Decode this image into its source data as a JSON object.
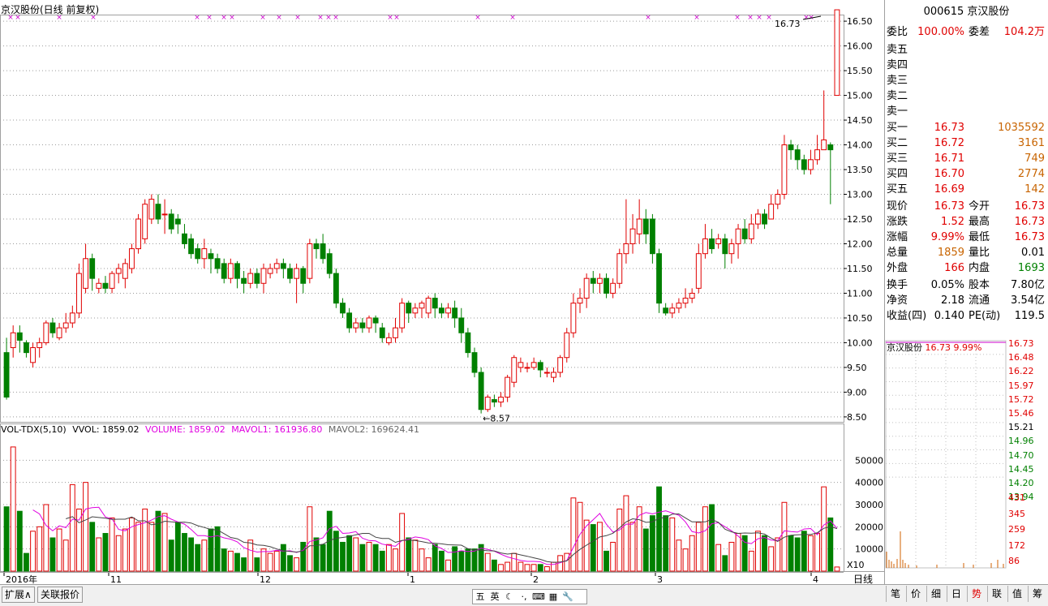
{
  "title": "京汉股份(日线 前复权)",
  "colors": {
    "up": "#e00000",
    "down": "#008000",
    "ma1": "#e000e0",
    "ma2": "#444444",
    "grid": "#9b9b9b",
    "axisText": "#000000",
    "marker": "#cc00cc"
  },
  "chart_data": {
    "type": "candlestick",
    "price_axis": {
      "min": 8.4,
      "max": 16.6,
      "ticks": [
        "16.50",
        "16.00",
        "15.50",
        "15.00",
        "14.50",
        "14.00",
        "13.50",
        "13.00",
        "12.50",
        "12.00",
        "11.50",
        "11.00",
        "10.50",
        "10.00",
        "9.50",
        "9.00",
        "8.50"
      ]
    },
    "volume_axis": {
      "max": 60000,
      "ticks": [
        "50000",
        "40000",
        "30000",
        "20000",
        "10000"
      ],
      "unit_label": "X10"
    },
    "x_labels": [
      "2016年",
      "11",
      "12",
      "1",
      "2",
      "3",
      "4"
    ],
    "period_label": "日线",
    "last_price_label": "16.73",
    "low_label": "8.57",
    "candles": [
      [
        9.8,
        8.9,
        10.1,
        8.85,
        29000
      ],
      [
        9.9,
        10.2,
        10.35,
        9.7,
        56000
      ],
      [
        10.2,
        10.05,
        10.35,
        9.8,
        27000
      ],
      [
        10.0,
        9.8,
        10.05,
        9.7,
        8000
      ],
      [
        9.6,
        9.9,
        10.0,
        9.5,
        18000
      ],
      [
        9.9,
        10.0,
        10.1,
        9.7,
        20000
      ],
      [
        10.0,
        10.4,
        10.45,
        9.95,
        30000
      ],
      [
        10.4,
        10.2,
        10.5,
        10.1,
        15000
      ],
      [
        10.1,
        10.3,
        10.4,
        10.05,
        19000
      ],
      [
        10.3,
        10.4,
        10.6,
        10.2,
        14000
      ],
      [
        10.4,
        10.6,
        10.75,
        10.3,
        39000
      ],
      [
        10.6,
        11.4,
        11.6,
        10.5,
        28000
      ],
      [
        11.1,
        11.7,
        12.0,
        11.0,
        40000
      ],
      [
        11.7,
        11.3,
        11.8,
        11.05,
        22000
      ],
      [
        11.1,
        11.2,
        11.3,
        11.0,
        15000
      ],
      [
        11.2,
        11.1,
        11.35,
        11.0,
        17000
      ],
      [
        11.1,
        11.4,
        11.45,
        11.0,
        24000
      ],
      [
        11.4,
        11.5,
        11.6,
        11.2,
        16000
      ],
      [
        11.3,
        11.6,
        11.7,
        11.1,
        19000
      ],
      [
        11.5,
        11.9,
        12.0,
        11.4,
        24000
      ],
      [
        11.9,
        12.5,
        12.6,
        11.8,
        22000
      ],
      [
        12.1,
        12.8,
        12.9,
        12.0,
        28000
      ],
      [
        12.5,
        12.9,
        13.0,
        12.4,
        22000
      ],
      [
        12.8,
        12.5,
        13.0,
        12.4,
        27000
      ],
      [
        12.6,
        12.6,
        12.9,
        12.2,
        26000
      ],
      [
        12.6,
        12.3,
        12.7,
        12.2,
        14000
      ],
      [
        12.5,
        12.4,
        12.6,
        12.2,
        22000
      ],
      [
        12.2,
        12.0,
        12.4,
        11.9,
        17000
      ],
      [
        12.1,
        11.8,
        12.2,
        11.7,
        15000
      ],
      [
        11.9,
        11.7,
        12.0,
        11.6,
        12000
      ],
      [
        11.7,
        11.9,
        12.1,
        11.5,
        14000
      ],
      [
        11.8,
        11.7,
        11.9,
        11.4,
        19000
      ],
      [
        11.7,
        11.5,
        11.8,
        11.4,
        20000
      ],
      [
        11.6,
        11.3,
        11.7,
        11.2,
        10000
      ],
      [
        11.3,
        11.6,
        11.7,
        11.2,
        9000
      ],
      [
        11.6,
        11.3,
        11.65,
        11.1,
        8000
      ],
      [
        11.3,
        11.2,
        11.45,
        11.0,
        6000
      ],
      [
        11.2,
        11.4,
        11.5,
        11.1,
        14000
      ],
      [
        11.4,
        11.2,
        11.5,
        11.1,
        6000
      ],
      [
        11.2,
        11.5,
        11.6,
        11.0,
        10000
      ],
      [
        11.4,
        11.5,
        11.6,
        11.3,
        8000
      ],
      [
        11.5,
        11.6,
        11.7,
        11.4,
        9000
      ],
      [
        11.6,
        11.5,
        11.7,
        11.3,
        12000
      ],
      [
        11.5,
        11.3,
        11.6,
        11.2,
        7000
      ],
      [
        11.3,
        11.5,
        11.6,
        10.8,
        6000
      ],
      [
        11.5,
        11.2,
        11.55,
        11.0,
        13000
      ],
      [
        11.3,
        12.0,
        12.1,
        11.2,
        29000
      ],
      [
        12.0,
        11.9,
        12.1,
        11.7,
        15000
      ],
      [
        12.0,
        11.7,
        12.2,
        11.6,
        12000
      ],
      [
        11.8,
        11.4,
        11.9,
        11.3,
        27000
      ],
      [
        11.4,
        10.8,
        11.5,
        10.7,
        18000
      ],
      [
        10.8,
        10.6,
        10.9,
        10.5,
        13000
      ],
      [
        10.6,
        10.3,
        10.7,
        10.2,
        16000
      ],
      [
        10.3,
        10.4,
        10.5,
        10.2,
        15000
      ],
      [
        10.4,
        10.3,
        10.5,
        10.2,
        12000
      ],
      [
        10.3,
        10.5,
        10.55,
        10.2,
        13000
      ],
      [
        10.5,
        10.4,
        10.55,
        10.2,
        12000
      ],
      [
        10.3,
        10.1,
        10.4,
        10.0,
        9000
      ],
      [
        10.0,
        10.1,
        10.2,
        9.95,
        12000
      ],
      [
        10.1,
        10.3,
        10.5,
        10.0,
        10000
      ],
      [
        10.3,
        10.8,
        10.9,
        10.2,
        26000
      ],
      [
        10.8,
        10.6,
        10.85,
        10.4,
        15000
      ],
      [
        10.6,
        10.7,
        10.8,
        10.5,
        14000
      ],
      [
        10.7,
        10.8,
        10.85,
        10.5,
        10000
      ],
      [
        10.6,
        10.9,
        10.95,
        10.5,
        6000
      ],
      [
        10.9,
        10.7,
        11.0,
        10.5,
        12000
      ],
      [
        10.7,
        10.6,
        10.8,
        10.5,
        9000
      ],
      [
        10.6,
        10.7,
        10.8,
        10.5,
        5000
      ],
      [
        10.7,
        10.5,
        10.85,
        10.3,
        11000
      ],
      [
        10.5,
        10.2,
        10.7,
        10.0,
        9000
      ],
      [
        10.2,
        9.8,
        10.3,
        9.7,
        10000
      ],
      [
        9.8,
        9.4,
        9.9,
        9.3,
        10000
      ],
      [
        9.4,
        8.65,
        9.5,
        8.57,
        12000
      ],
      [
        8.65,
        8.9,
        8.95,
        8.6,
        8000
      ],
      [
        8.85,
        8.8,
        8.95,
        8.7,
        5000
      ],
      [
        8.8,
        8.9,
        9.0,
        8.7,
        3000
      ],
      [
        8.9,
        9.3,
        9.35,
        8.8,
        4000
      ],
      [
        9.2,
        9.7,
        9.75,
        9.1,
        8000
      ],
      [
        9.5,
        9.6,
        9.7,
        9.4,
        4000
      ],
      [
        9.5,
        9.5,
        9.6,
        9.4,
        3000
      ],
      [
        9.5,
        9.6,
        9.7,
        9.45,
        3000
      ],
      [
        9.6,
        9.45,
        9.65,
        9.3,
        3000
      ],
      [
        9.4,
        9.4,
        9.5,
        9.3,
        2000
      ],
      [
        9.3,
        9.4,
        9.5,
        9.2,
        4000
      ],
      [
        9.4,
        9.7,
        9.75,
        9.3,
        7000
      ],
      [
        9.7,
        10.2,
        10.3,
        9.6,
        8000
      ],
      [
        10.2,
        10.8,
        11.0,
        10.1,
        33000
      ],
      [
        10.8,
        10.9,
        11.1,
        10.6,
        31000
      ],
      [
        10.9,
        11.3,
        11.4,
        10.7,
        23000
      ],
      [
        11.3,
        11.2,
        11.45,
        11.0,
        21000
      ],
      [
        11.2,
        11.3,
        11.4,
        11.0,
        22000
      ],
      [
        11.3,
        11.0,
        11.4,
        10.9,
        9000
      ],
      [
        11.0,
        11.2,
        11.3,
        10.9,
        13000
      ],
      [
        11.2,
        11.8,
        11.9,
        11.1,
        28000
      ],
      [
        11.8,
        12.0,
        12.9,
        11.6,
        34000
      ],
      [
        12.0,
        12.3,
        12.6,
        11.8,
        22000
      ],
      [
        12.2,
        12.5,
        12.9,
        12.0,
        29000
      ],
      [
        12.5,
        12.2,
        12.7,
        12.0,
        19000
      ],
      [
        12.5,
        11.8,
        12.6,
        11.6,
        25000
      ],
      [
        11.8,
        10.8,
        11.9,
        10.6,
        38000
      ],
      [
        10.7,
        10.6,
        10.8,
        10.55,
        25000
      ],
      [
        10.6,
        10.7,
        10.8,
        10.5,
        24000
      ],
      [
        10.7,
        10.8,
        10.9,
        10.6,
        14000
      ],
      [
        10.8,
        10.9,
        11.1,
        10.7,
        10000
      ],
      [
        10.9,
        11.0,
        11.1,
        10.8,
        16000
      ],
      [
        11.1,
        11.8,
        12.0,
        11.0,
        22000
      ],
      [
        11.8,
        12.1,
        12.4,
        11.7,
        29000
      ],
      [
        12.1,
        11.9,
        12.3,
        11.8,
        30000
      ],
      [
        12.0,
        12.1,
        12.2,
        11.9,
        12000
      ],
      [
        12.1,
        11.8,
        12.2,
        11.5,
        7000
      ],
      [
        11.8,
        12.0,
        12.1,
        11.6,
        13000
      ],
      [
        12.0,
        12.3,
        12.4,
        11.7,
        17000
      ],
      [
        12.3,
        12.1,
        12.5,
        12.0,
        16000
      ],
      [
        12.1,
        12.4,
        12.6,
        12.0,
        9000
      ],
      [
        12.4,
        12.6,
        12.7,
        12.3,
        18000
      ],
      [
        12.6,
        12.4,
        12.7,
        12.3,
        16000
      ],
      [
        12.5,
        12.8,
        13.0,
        12.5,
        11000
      ],
      [
        12.8,
        13.0,
        13.1,
        12.7,
        15000
      ],
      [
        13.0,
        14.0,
        14.2,
        12.9,
        31000
      ],
      [
        14.0,
        13.9,
        14.1,
        13.7,
        16000
      ],
      [
        13.9,
        13.7,
        14.0,
        13.5,
        15000
      ],
      [
        13.7,
        13.5,
        13.8,
        13.4,
        18000
      ],
      [
        13.5,
        13.7,
        13.9,
        13.4,
        16000
      ],
      [
        13.7,
        13.9,
        14.2,
        13.6,
        17000
      ],
      [
        13.9,
        14.1,
        15.1,
        13.9,
        38000
      ],
      [
        14.0,
        13.9,
        14.05,
        12.8,
        24000
      ],
      [
        15.0,
        16.73,
        16.73,
        15.0,
        1859
      ]
    ],
    "ma_volume": {
      "name1": "MAVOL1",
      "name2": "MAVOL2"
    }
  },
  "vol_legend": {
    "name": "VOL-TDX(5,10)",
    "vvol": "VVOL: 1859.02",
    "volume": "VOLUME: 1859.02",
    "mavol1": "MAVOL1: 161936.80",
    "mavol2": "MAVOL2: 169624.41"
  },
  "panel": {
    "code_name": "000615 京汉股份",
    "weibi": {
      "label": "委比",
      "value": "100.00%",
      "label2": "委差",
      "value2": "104.2万"
    },
    "sell": [
      {
        "label": "卖五"
      },
      {
        "label": "卖四"
      },
      {
        "label": "卖三"
      },
      {
        "label": "卖二"
      },
      {
        "label": "卖一"
      }
    ],
    "buy": [
      {
        "label": "买一",
        "price": "16.73",
        "vol": "1035592"
      },
      {
        "label": "买二",
        "price": "16.72",
        "vol": "3161"
      },
      {
        "label": "买三",
        "price": "16.71",
        "vol": "749"
      },
      {
        "label": "买四",
        "price": "16.70",
        "vol": "2774"
      },
      {
        "label": "买五",
        "price": "16.69",
        "vol": "142"
      }
    ],
    "stats1": [
      {
        "l": "现价",
        "v": "16.73",
        "l2": "今开",
        "v2": "16.73"
      },
      {
        "l": "涨跌",
        "v": "1.52",
        "l2": "最高",
        "v2": "16.73"
      },
      {
        "l": "涨幅",
        "v": "9.99%",
        "l2": "最低",
        "v2": "16.73"
      },
      {
        "l": "总量",
        "v": "1859",
        "l2": "量比",
        "v2": "0.01"
      },
      {
        "l": "外盘",
        "v": "166",
        "l2": "内盘",
        "v2": "1693"
      }
    ],
    "stats2": [
      {
        "l": "换手",
        "v": "0.05%",
        "l2": "股本",
        "v2": "7.80亿"
      },
      {
        "l": "净资",
        "v": "2.18",
        "l2": "流通",
        "v2": "3.54亿"
      },
      {
        "l": "收益(四)",
        "v": "0.140",
        "l2": "PE(动)",
        "v2": "119.5"
      }
    ]
  },
  "intraday": {
    "header_name": "京汉股份",
    "header_price": "16.73",
    "header_pct": "9.99%",
    "price_ticks": [
      "16.73",
      "16.48",
      "16.22",
      "15.97",
      "15.72",
      "15.46",
      "15.21",
      "14.96",
      "14.70",
      "14.45",
      "14.20",
      "13.94"
    ],
    "vol_ticks": [
      "431",
      "345",
      "259",
      "172",
      "86"
    ]
  },
  "bottom": {
    "tab1": "扩展∧",
    "tab2": "关联报价",
    "ime": [
      "五",
      "英",
      "☾",
      "·,",
      "⌨",
      "▦",
      "🔧"
    ],
    "right_buttons": [
      "笔",
      "价",
      "细",
      "日",
      "势",
      "联",
      "值",
      "筹"
    ]
  }
}
